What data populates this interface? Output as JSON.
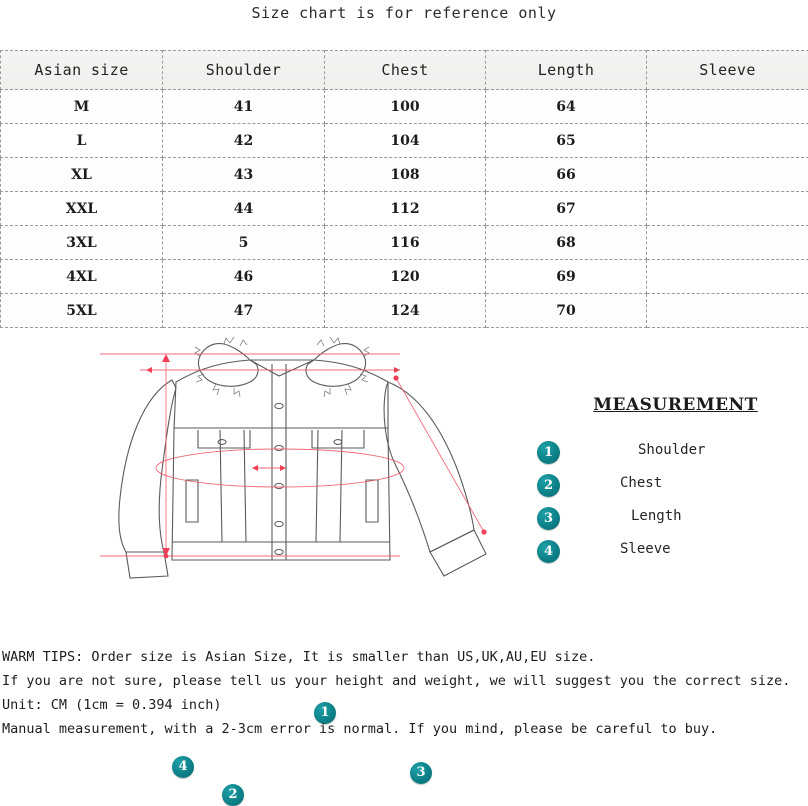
{
  "title": "Size chart is for reference only",
  "table": {
    "headers": [
      "Asian size",
      "Shoulder",
      "Chest",
      "Length",
      "Sleeve"
    ],
    "rows": [
      {
        "size": "M",
        "shoulder": "41",
        "chest": "100",
        "length": "64",
        "sleeve": ""
      },
      {
        "size": "L",
        "shoulder": "42",
        "chest": "104",
        "length": "65",
        "sleeve": ""
      },
      {
        "size": "XL",
        "shoulder": "43",
        "chest": "108",
        "length": "66",
        "sleeve": ""
      },
      {
        "size": "XXL",
        "shoulder": "44",
        "chest": "112",
        "length": "67",
        "sleeve": ""
      },
      {
        "size": "3XL",
        "shoulder": "5",
        "chest": "116",
        "length": "68",
        "sleeve": ""
      },
      {
        "size": "4XL",
        "shoulder": "46",
        "chest": "120",
        "length": "69",
        "sleeve": ""
      },
      {
        "size": "5XL",
        "shoulder": "47",
        "chest": "124",
        "length": "70",
        "sleeve": ""
      }
    ]
  },
  "diagram": {
    "markers": [
      {
        "number": "1",
        "measures": "Shoulder"
      },
      {
        "number": "2",
        "measures": "Chest"
      },
      {
        "number": "3",
        "measures": "Length"
      },
      {
        "number": "4",
        "measures": "Sleeve"
      }
    ]
  },
  "legend": {
    "title": "MEASUREMENT",
    "items": [
      {
        "number": "1",
        "label": "Shoulder"
      },
      {
        "number": "2",
        "label": "Chest"
      },
      {
        "number": "3",
        "label": "Length"
      },
      {
        "number": "4",
        "label": "Sleeve"
      }
    ]
  },
  "tips": {
    "lines": [
      "WARM TIPS: Order size is Asian Size, It is smaller than US,UK,AU,EU size.",
      "If you are not sure, please tell us your height and weight, we will suggest you the correct size.",
      "Unit: CM (1cm = 0.394 inch)",
      "Manual measurement, with a 2-3cm error is normal. If you mind, please be careful to buy."
    ]
  },
  "colors": {
    "badge_teal": "#0d8189",
    "measure_line": "#ef5a6a",
    "garment_outline": "#5b5b5b",
    "table_border": "#9a9a9a"
  }
}
